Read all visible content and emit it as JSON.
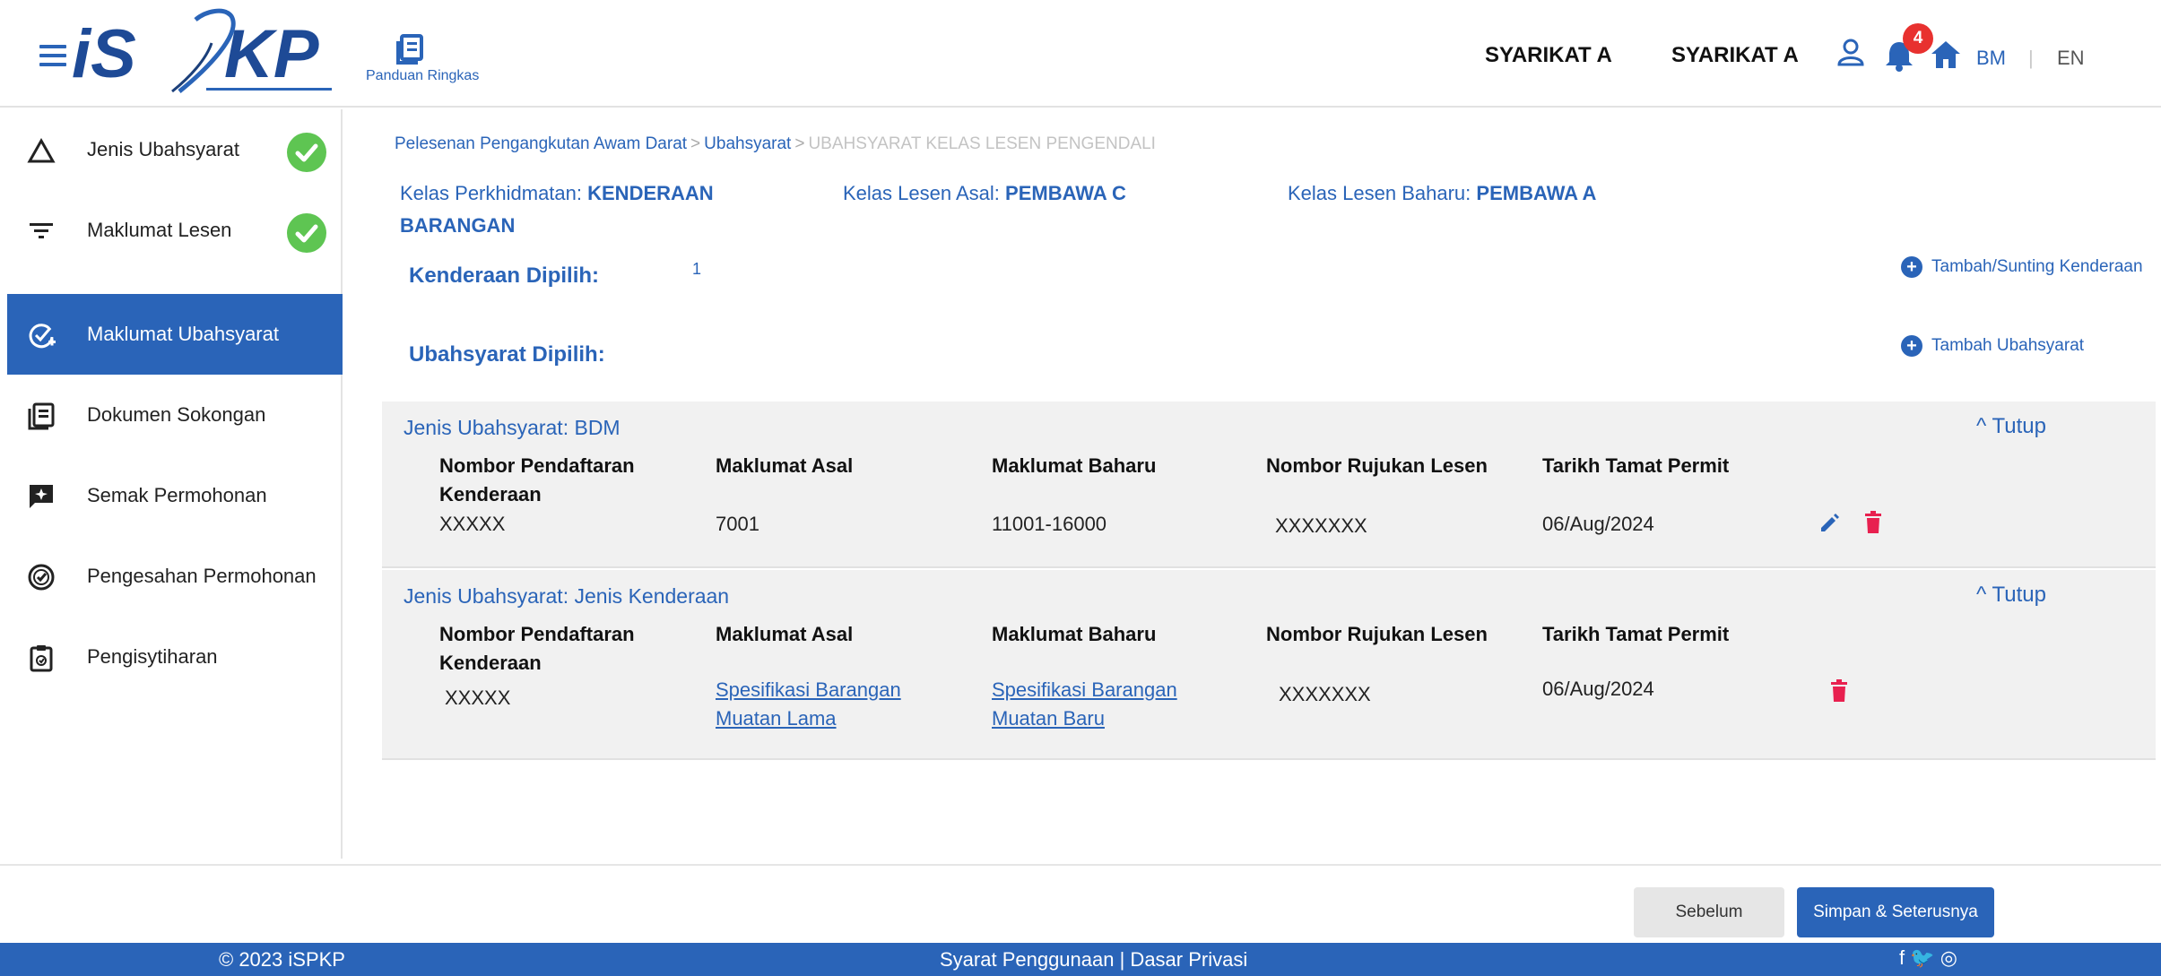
{
  "header": {
    "logo_text": "iSPKP",
    "guide_label": "Panduan Ringkas",
    "company_1": "SYARIKAT A",
    "company_2": "SYARIKAT A",
    "notification_count": "4",
    "lang_bm": "BM",
    "lang_sep": "|",
    "lang_en": "EN"
  },
  "sidebar": {
    "items": [
      {
        "label": "Jenis Ubahsyarat",
        "icon": "triangle-icon",
        "completed": true
      },
      {
        "label": "Maklumat Lesen",
        "icon": "filter-icon",
        "completed": true
      },
      {
        "label": "Maklumat Ubahsyarat",
        "icon": "check-add-icon",
        "active": true
      },
      {
        "label": "Dokumen Sokongan",
        "icon": "document-icon"
      },
      {
        "label": "Semak Permohonan",
        "icon": "review-icon"
      },
      {
        "label": "Pengesahan Permohonan",
        "icon": "verified-icon"
      },
      {
        "label": "Pengisytiharan",
        "icon": "clipboard-icon"
      }
    ]
  },
  "breadcrumb": {
    "item_1": "Pelesenan Pengangkutan Awam Darat",
    "item_2": "Ubahsyarat",
    "current": "UBAHSYARAT KELAS LESEN PENGENDALI",
    "separator": ">"
  },
  "info": {
    "service_label": "Kelas Perkhidmatan:",
    "service_value_1": "KENDERAAN",
    "service_value_2": "BARANGAN",
    "orig_label": "Kelas Lesen Asal:",
    "orig_value": "PEMBAWA C",
    "new_label": "Kelas Lesen Baharu:",
    "new_value": "PEMBAWA A"
  },
  "selection": {
    "vehicles_label": "Kenderaan Dipilih:",
    "vehicles_count": "1",
    "add_vehicle": "Tambah/Sunting Kenderaan",
    "conditions_label": "Ubahsyarat Dipilih:",
    "add_condition": "Tambah Ubahsyarat"
  },
  "columns": {
    "reg_no_1": "Nombor Pendaftaran",
    "reg_no_2": "Kenderaan",
    "orig_info": "Maklumat Asal",
    "new_info": "Maklumat Baharu",
    "license_ref": "Nombor Rujukan Lesen",
    "permit_expiry": "Tarikh Tamat Permit"
  },
  "panels": [
    {
      "title": "Jenis Ubahsyarat: BDM",
      "toggle": "^ Tutup",
      "reg_no": "XXXXX",
      "orig_info": "7001",
      "new_info": "11001-16000",
      "license_ref": "XXXXXXX",
      "permit_expiry": "06/Aug/2024"
    },
    {
      "title": "Jenis Ubahsyarat: Jenis Kenderaan",
      "toggle": "^ Tutup",
      "reg_no": "XXXXX",
      "orig_info_1": "Spesifikasi Barangan",
      "orig_info_2": "Muatan Lama",
      "new_info_1": "Spesifikasi Barangan",
      "new_info_2": "Muatan Baru",
      "license_ref": "XXXXXXX",
      "permit_expiry": "06/Aug/2024"
    }
  ],
  "buttons": {
    "back": "Sebelum",
    "next": "Simpan & Seterusnya"
  },
  "footer": {
    "copyright": "© 2023 iSPKP",
    "links": "Syarat Penggunaan | Dasar Privasi",
    "social": "f 🐦 ◎"
  },
  "colors": {
    "primary": "#2a64b8",
    "success": "#5ec552",
    "danger": "#e8204f",
    "badge": "#e8312f"
  }
}
